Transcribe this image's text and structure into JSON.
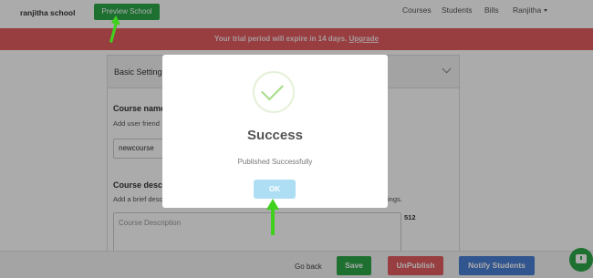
{
  "header": {
    "brand": "ranjitha school",
    "preview_label": "Preview School",
    "nav": [
      "Courses",
      "Students",
      "Bills",
      "Ranjitha"
    ]
  },
  "banner": {
    "message": "Your trial period will expire in 14 days.",
    "link": "Upgrade"
  },
  "settings": {
    "section_title": "Basic Settings",
    "course_name_label": "Course name",
    "course_name_help": "Add user friend",
    "course_name_value": "newcourse",
    "course_desc_label": "Course descr",
    "course_desc_help_start": "Add a brief desc",
    "course_desc_help_end": "ings.",
    "course_desc_placeholder": "Course Description",
    "char_count": "512"
  },
  "footer": {
    "go_back": "Go back",
    "save": "Save",
    "unpublish": "UnPublish",
    "notify": "Notify Students"
  },
  "modal": {
    "title": "Success",
    "message": "Published Successfully",
    "ok": "OK"
  },
  "colors": {
    "green": "#2ea84a",
    "red": "#e35d61",
    "blue": "#4a7fd4",
    "ok_button": "#aedef4",
    "check": "#a5dc86"
  },
  "icons": [
    "check-icon",
    "chevron-down-icon",
    "caret-down-icon",
    "chat-icon",
    "arrow-up-icon"
  ]
}
